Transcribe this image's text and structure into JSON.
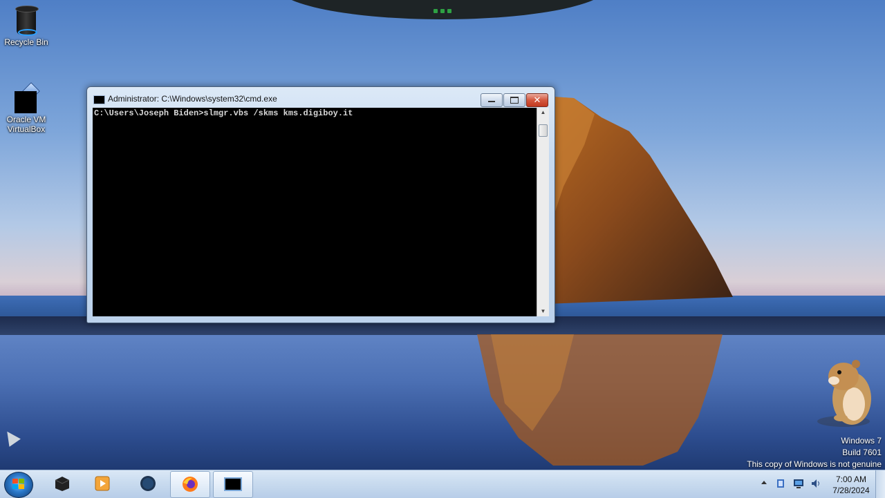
{
  "desktop": {
    "icons": [
      {
        "label": "Recycle Bin"
      },
      {
        "label_line1": "Oracle VM",
        "label_line2": "VirtualBox"
      }
    ],
    "watermark": {
      "line1": "Windows 7",
      "line2": "Build 7601",
      "line3": "This copy of Windows is not genuine"
    }
  },
  "window": {
    "title": "Administrator: C:\\Windows\\system32\\cmd.exe",
    "console_line": "C:\\Users\\Joseph Biden>slmgr.vbs /skms kms.digiboy.it",
    "close_symbol": "✕"
  },
  "taskbar": {
    "items": [
      "start-button",
      "virtualbox",
      "media-player",
      "globe-app",
      "firefox",
      "command-prompt"
    ],
    "clock": {
      "time": "7:00 AM",
      "date": "7/28/2024"
    }
  }
}
